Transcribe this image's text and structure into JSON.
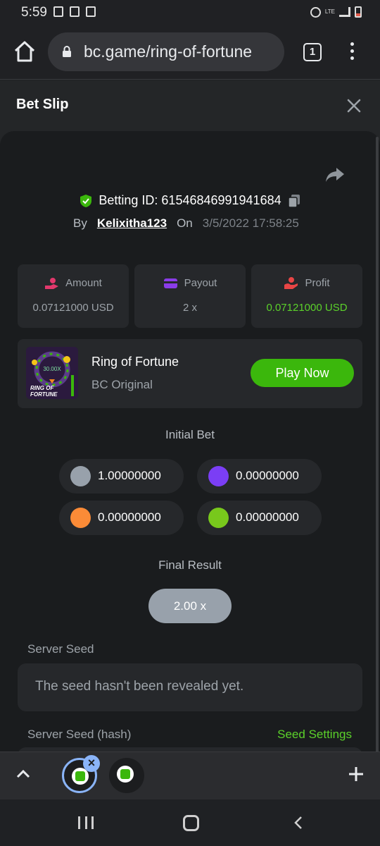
{
  "status_bar": {
    "time": "5:59",
    "lte_label": "LTE"
  },
  "browser": {
    "url": "bc.game/ring-of-fortune",
    "tab_count": "1"
  },
  "bet_slip": {
    "title": "Bet Slip",
    "betting_id_label": "Betting ID: 61546846991941684",
    "by_label": "By",
    "username": "Kelixitha123",
    "on_label": "On",
    "datetime": "3/5/2022 17:58:25",
    "stats": [
      {
        "label": "Amount",
        "value": "0.07121000 USD",
        "color": "#e2386c"
      },
      {
        "label": "Payout",
        "value": "2 x",
        "color": "#8a3ce8"
      },
      {
        "label": "Profit",
        "value": "0.07121000 USD",
        "color": "#e84545"
      }
    ],
    "game": {
      "name": "Ring of Fortune",
      "provider": "BC Original",
      "play_label": "Play Now",
      "thumb_text_top": "30.00X",
      "thumb_text_1": "RING OF",
      "thumb_text_2": "FORTUNE"
    },
    "initial_bet_label": "Initial Bet",
    "initial_bets": [
      {
        "color": "#98a1ab",
        "value": "1.00000000"
      },
      {
        "color": "#7b3ef5",
        "value": "0.00000000"
      },
      {
        "color": "#fb8b37",
        "value": "0.00000000"
      },
      {
        "color": "#78c81c",
        "value": "0.00000000"
      }
    ],
    "final_result_label": "Final Result",
    "final_result": "2.00 x",
    "server_seed_label": "Server Seed",
    "server_seed_placeholder": "The seed hasn't been revealed yet.",
    "server_seed_hash_label": "Server Seed (hash)",
    "seed_settings_label": "Seed Settings"
  },
  "colors": {
    "accent_green": "#3bb70c",
    "profit_green": "#5bd12a",
    "tab_highlight": "#8ab4f8"
  }
}
